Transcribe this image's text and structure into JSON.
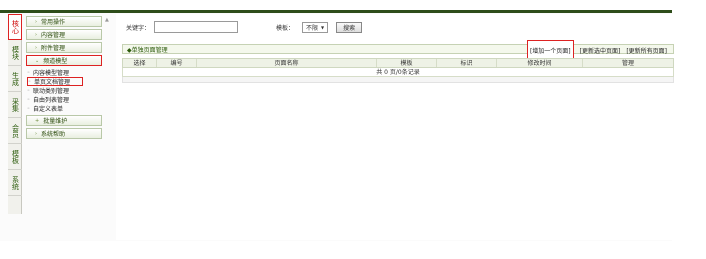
{
  "vtabs": [
    {
      "label": "核心",
      "active": true
    },
    {
      "label": "模块",
      "active": false
    },
    {
      "label": "生成",
      "active": false
    },
    {
      "label": "采集",
      "active": false
    },
    {
      "label": "会员",
      "active": false
    },
    {
      "label": "模板",
      "active": false
    },
    {
      "label": "系统",
      "active": false
    }
  ],
  "menu": {
    "groups_top": [
      "常用操作",
      "内容管理",
      "附件管理"
    ],
    "active_group": "频道模型",
    "subitems": [
      "内容模型管理",
      "单页文档管理",
      "联动类别管理",
      "自由列表管理",
      "自定义表单"
    ],
    "groups_bottom": [
      "批量维护",
      "系统帮助"
    ],
    "group_arrow": "›",
    "expanded_arrow": "⌄",
    "collapsed_bottom_arrow": "+",
    "sub_dot": "◦"
  },
  "search": {
    "keyword_label": "关键字：",
    "keyword_value": "",
    "template_label": "模板：",
    "template_value": "不限",
    "template_arrow": "▼",
    "button": "搜索"
  },
  "title": {
    "text": "◆单独页面管理",
    "links": [
      "[增加一个页面]",
      "[更新选中页面]",
      "[更新所有页面]"
    ]
  },
  "table": {
    "columns": [
      "选择",
      "编号",
      "页面名称",
      "模板",
      "标识",
      "修改时间",
      "管理"
    ],
    "footer": "共 0 页/0条记录"
  },
  "misc": {
    "scroll_arrow": "▲"
  }
}
